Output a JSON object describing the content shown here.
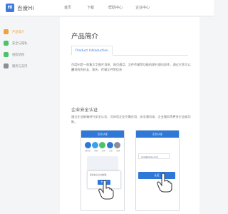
{
  "header": {
    "logo_text": "百度Hi",
    "nav": [
      "首页",
      "下载",
      "帮助中心",
      "企业中心"
    ]
  },
  "sidebar": {
    "items": [
      {
        "label": "产品简介",
        "icon": "product-icon",
        "color": "#f0a03c"
      },
      {
        "label": "安全与隐私",
        "icon": "security-icon",
        "color": "#4cc26b"
      },
      {
        "label": "组织结构",
        "icon": "org-icon",
        "color": "#4cc26b"
      },
      {
        "label": "服务与支持",
        "icon": "support-icon",
        "color": "#8a8f96"
      }
    ]
  },
  "main": {
    "title": "产品简介",
    "tab_label": "Product Introduction",
    "intro_lines": [
      "百度Hi是一款集文字图片消息、网页通话、文件传输等功能的即时通讯软件。通过它您可以方",
      "便地找到好友、聊天、传输文件等信息"
    ],
    "section_title": "企业安全认证",
    "section_lines": [
      "通过企业邮箱进行安全认证，可体验企业专属应用、安全通讯录、企业服务等更多企业级功能。"
    ]
  },
  "phone_left": {
    "header": "企业认证",
    "icon_labels": [
      "通讯录",
      "群组",
      "应用",
      "公告",
      "更多"
    ],
    "dialog_text": "您还未认证企业邮箱",
    "dialog_button": "去认证"
  },
  "phone_right": {
    "header": "企业认证",
    "email_value": "xxx@baidu.com",
    "button": "认证"
  },
  "colors": {
    "accent": "#2f78d8",
    "sidebar_active": "#f0a03c",
    "sidebar_green": "#4cc26b"
  }
}
